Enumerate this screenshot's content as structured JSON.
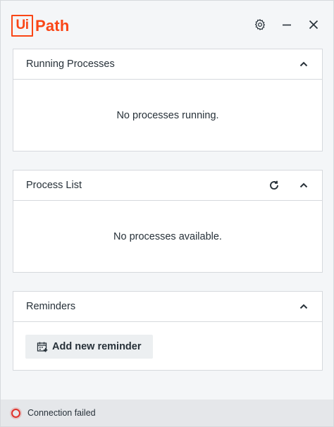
{
  "app": {
    "logo_box_text": "Ui",
    "logo_text": "Path",
    "brand_color": "#fa4616"
  },
  "header": {
    "icons": [
      "gear-icon",
      "minimize-icon",
      "close-icon"
    ]
  },
  "panels": {
    "running": {
      "title": "Running Processes",
      "empty_text": "No processes running.",
      "collapse_icon": "chevron-up-icon"
    },
    "process_list": {
      "title": "Process List",
      "empty_text": "No processes available.",
      "refresh_icon": "refresh-icon",
      "collapse_icon": "chevron-up-icon"
    },
    "reminders": {
      "title": "Reminders",
      "add_button_label": "Add new reminder",
      "add_icon": "calendar-add-icon",
      "collapse_icon": "chevron-up-icon"
    }
  },
  "status": {
    "text": "Connection failed",
    "color": "#e0322b"
  }
}
